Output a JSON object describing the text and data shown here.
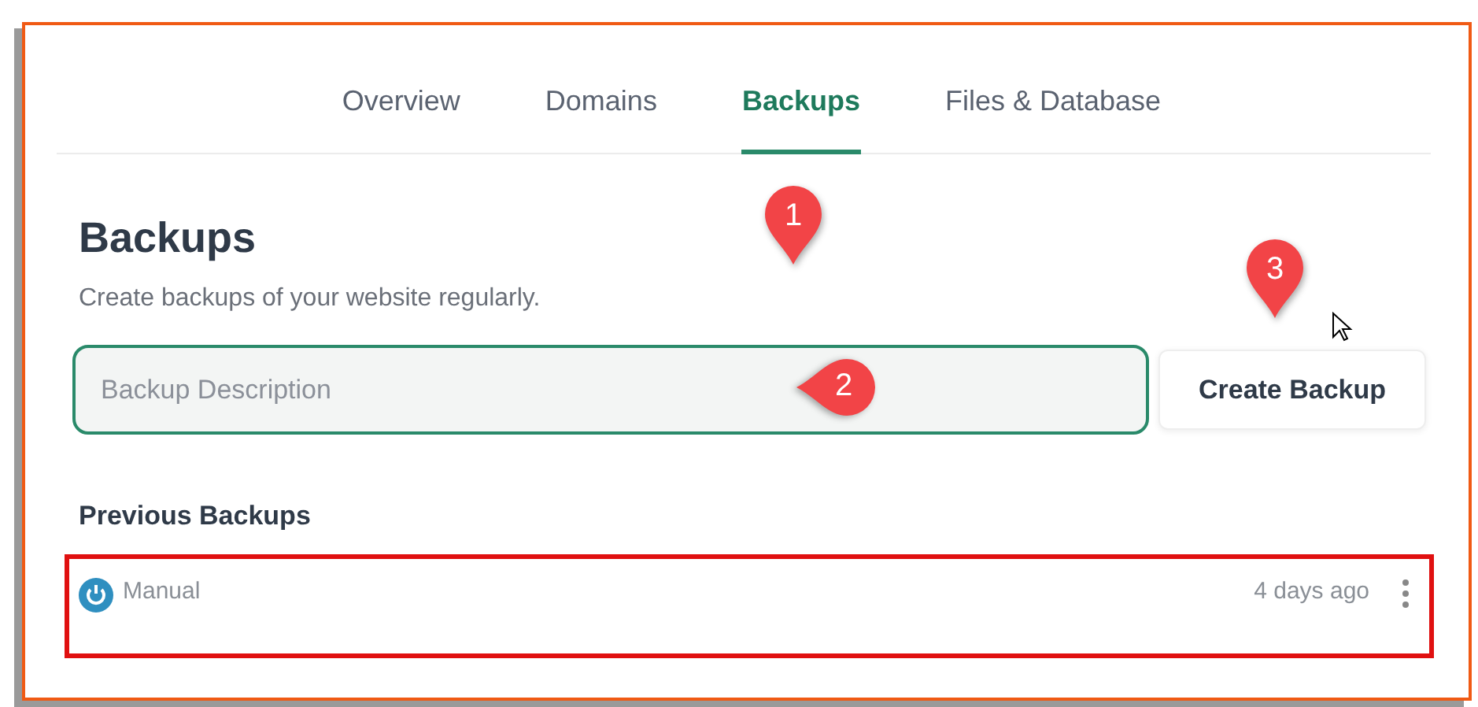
{
  "tabs": [
    {
      "label": "Overview",
      "selected": false
    },
    {
      "label": "Domains",
      "selected": false
    },
    {
      "label": "Backups",
      "selected": true
    },
    {
      "label": "Files & Database",
      "selected": false
    }
  ],
  "heading": "Backups",
  "subtitle": "Create backups of your website regularly.",
  "backup_form": {
    "placeholder": "Backup Description",
    "button": "Create Backup"
  },
  "previous_backups": {
    "title": "Previous Backups",
    "rows": [
      {
        "type": "Manual",
        "time": "4 days ago",
        "highlighted": true
      }
    ]
  },
  "markers": [
    {
      "number": "1",
      "kind": "pin-down"
    },
    {
      "number": "2",
      "kind": "pin-left"
    },
    {
      "number": "3",
      "kind": "pin-down"
    }
  ]
}
